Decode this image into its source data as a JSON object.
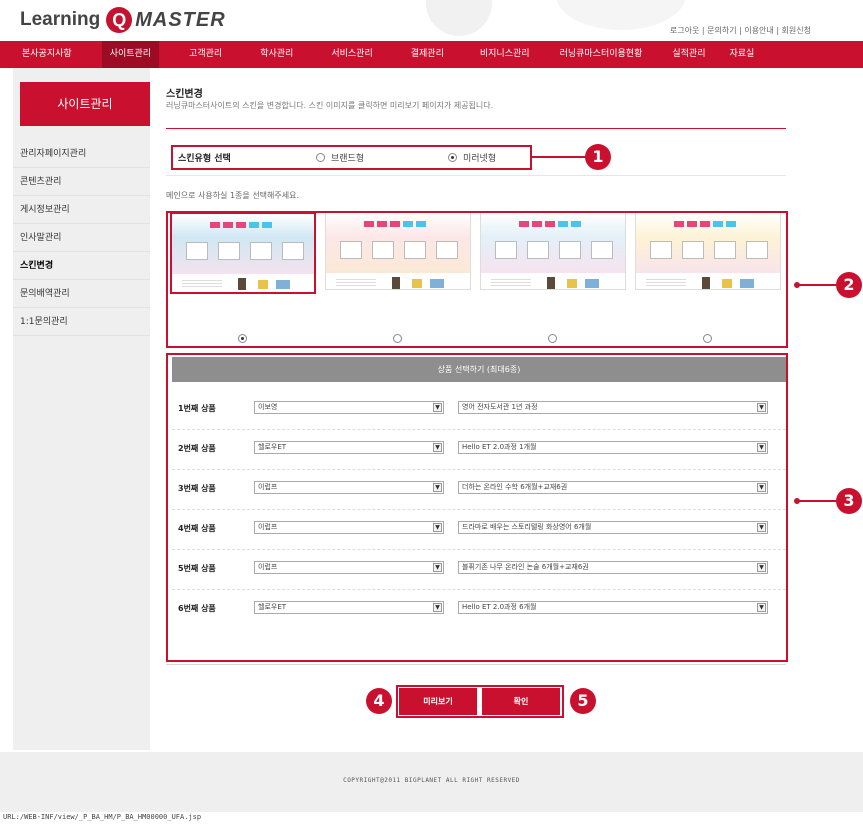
{
  "header": {
    "logo_learning": "Learning",
    "logo_q": "Q",
    "logo_master": "MASTER",
    "top_menu": "로그아웃 | 문의하기 | 이용안내 | 회원신청"
  },
  "gnb": [
    {
      "label": "본사공지사항"
    },
    {
      "label": "사이트관리"
    },
    {
      "label": "고객관리"
    },
    {
      "label": "학사관리"
    },
    {
      "label": "서비스관리"
    },
    {
      "label": "결제관리"
    },
    {
      "label": "비지니스관리"
    },
    {
      "label": "러닝큐마스터이용현황"
    },
    {
      "label": "실적관리"
    },
    {
      "label": "자료실"
    }
  ],
  "sidebar": {
    "title": "사이트관리",
    "items": [
      {
        "label": "관리자페이지관리"
      },
      {
        "label": "콘텐츠관리"
      },
      {
        "label": "게시정보관리"
      },
      {
        "label": "인사말관리"
      },
      {
        "label": "스킨변경"
      },
      {
        "label": "문의배역관리"
      },
      {
        "label": "1:1문의관리"
      }
    ]
  },
  "content": {
    "title": "스킨변경",
    "desc": "러닝큐마스터사이트의 스킨을 변경합니다. 스킨 이미지를 클릭하면 미리보기 페이지가 제공됩니다.",
    "skin_type_label": "스킨유형 선택",
    "skin_type_options": [
      {
        "label": "브랜드형",
        "selected": false
      },
      {
        "label": "미러넷형",
        "selected": true
      }
    ],
    "pick_text": "메인으로 사용하실 1종을 선택해주세요.",
    "thumbnails": [
      {
        "bg": "#cfe7f3",
        "selected": true
      },
      {
        "bg": "#fde7e7",
        "selected": false
      },
      {
        "bg": "#e3f0f8",
        "selected": false
      },
      {
        "bg": "#fdf3d5",
        "selected": false
      }
    ]
  },
  "goods": {
    "header": "상품 선택하기 (최대6종)",
    "rows": [
      {
        "label": "1번째 상품",
        "category": "이보영",
        "product": "영어 전자도서관 1년 과정"
      },
      {
        "label": "2번째 상품",
        "category": "헬로우ET",
        "product": "Hello ET 2.0과정 1개월"
      },
      {
        "label": "3번째 상품",
        "category": "이럽프",
        "product": "더하는 온라인 수학 6개월+교재6권"
      },
      {
        "label": "4번째 상품",
        "category": "이럽프",
        "product": "드라마로 배우는 스토리텔링 화상영어 6개월"
      },
      {
        "label": "5번째 상품",
        "category": "이럽프",
        "product": "블퓌기존 나무 온라인 논술 6개월+교재6권"
      },
      {
        "label": "6번째 상품",
        "category": "헬로우ET",
        "product": "Hello ET 2.0과정 6개월"
      }
    ]
  },
  "buttons": {
    "preview": "미리보기",
    "confirm": "확인"
  },
  "callouts": {
    "c1": "1",
    "c2": "2",
    "c3": "3",
    "c4": "4",
    "c5": "5"
  },
  "footer": {
    "copyright": "COPYRIGHT@2011 BIGPLANET ALL RIGHT RESERVED",
    "url": "URL:/WEB-INF/view/_P_BA_HM/P_BA_HM00000_UFA.jsp"
  },
  "colors": {
    "brand_red": "#c9112f",
    "gnb_active": "#9e0b24",
    "goods_header": "#8e8e8e"
  }
}
